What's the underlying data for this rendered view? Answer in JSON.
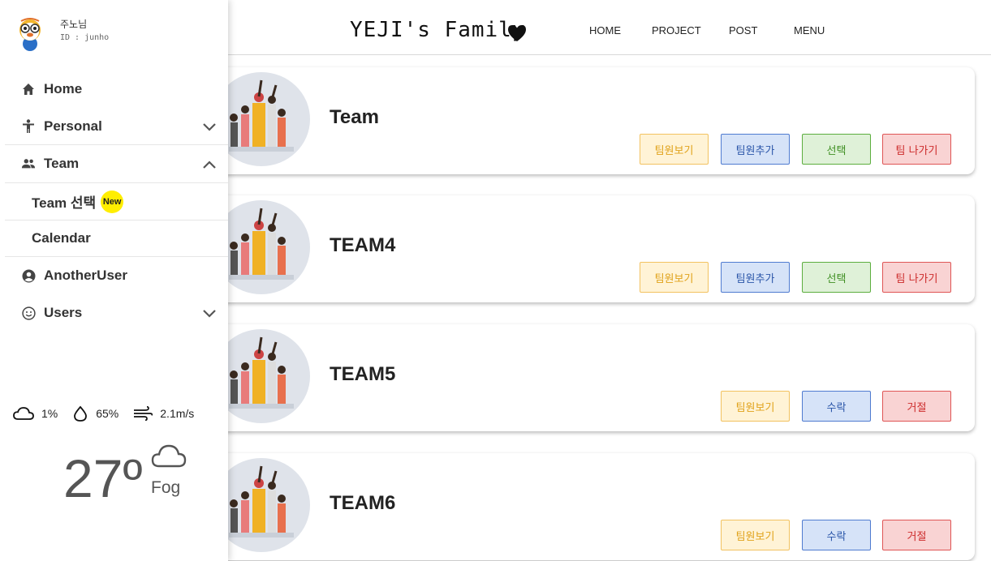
{
  "profile": {
    "name": "주노님",
    "id_text": "ID : junho"
  },
  "sidebar": {
    "items": [
      {
        "label": "Home",
        "icon": "home-icon"
      },
      {
        "label": "Personal",
        "icon": "person-icon",
        "chevron": "chevron-down-icon"
      },
      {
        "label": "Team",
        "icon": "group-icon",
        "chevron": "chevron-up-icon"
      },
      {
        "label": "Team 선택",
        "badge": "New"
      },
      {
        "label": "Calendar"
      },
      {
        "label": "AnotherUser",
        "icon": "user-circle-icon"
      },
      {
        "label": "Users",
        "icon": "smile-icon",
        "chevron": "chevron-down-icon"
      }
    ]
  },
  "weather": {
    "cloud": "1%",
    "humidity": "65%",
    "wind": "2.1m/s",
    "temperature": "27º",
    "condition": "Fog"
  },
  "header": {
    "brand": "YEJI's Family",
    "nav": [
      "HOME",
      "PROJECT",
      "POST",
      "MENU"
    ]
  },
  "teams": [
    {
      "name": "Team",
      "buttons": [
        "팀원보기",
        "팀원추가",
        "선택",
        "팀 나가기"
      ]
    },
    {
      "name": "TEAM4",
      "buttons": [
        "팀원보기",
        "팀원추가",
        "선택",
        "팀 나가기"
      ]
    },
    {
      "name": "TEAM5",
      "buttons": [
        "팀원보기",
        "수락",
        "거절"
      ]
    },
    {
      "name": "TEAM6",
      "buttons": [
        "팀원보기",
        "수락",
        "거절"
      ]
    }
  ],
  "colors": {
    "view": "#e0a21a",
    "add": "#2a55a8",
    "select": "#3f8f22",
    "leave": "#cc2a2a",
    "badge": "#ffee00"
  }
}
